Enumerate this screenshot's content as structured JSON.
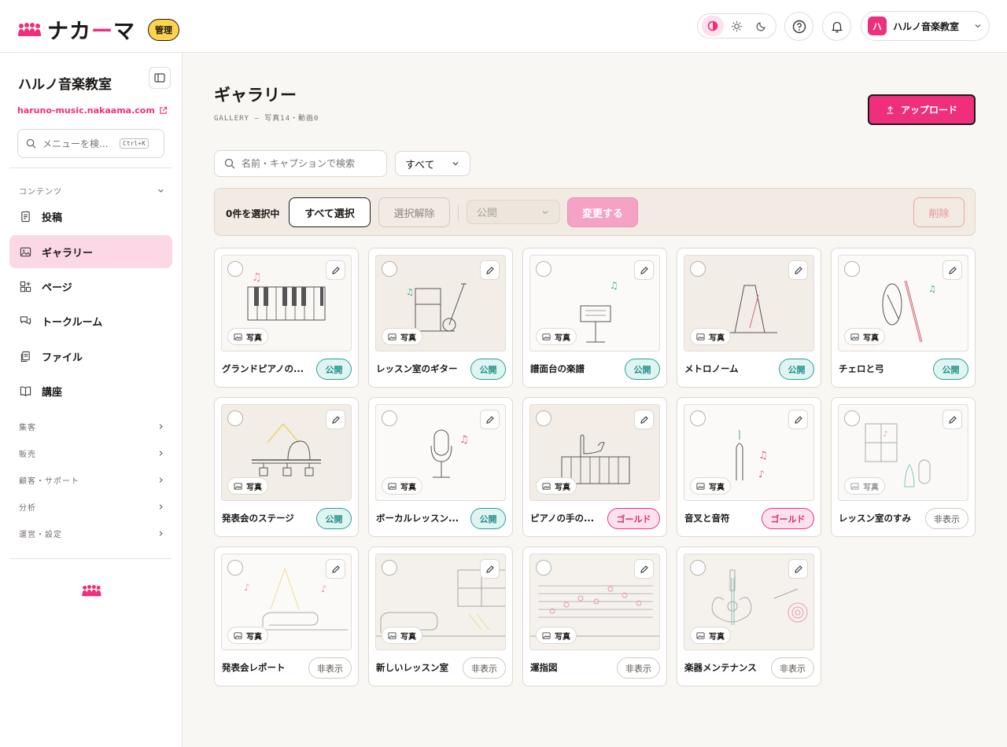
{
  "app": {
    "logo_text_pre": "ナカ",
    "logo_text_accent": "ー",
    "logo_text_post": "マ",
    "admin_badge": "管理"
  },
  "header": {
    "user_initial": "ハ",
    "user_name": "ハルノ音楽教室"
  },
  "sidebar": {
    "site_name": "ハルノ音楽教室",
    "site_url": "haruno-music.nakaama.com",
    "search_placeholder": "メニューを検...",
    "search_shortcut": "Ctrl+K",
    "content_section": "コンテンツ",
    "items": [
      {
        "label": "投稿",
        "icon": "document-icon"
      },
      {
        "label": "ギャラリー",
        "icon": "image-icon",
        "active": true
      },
      {
        "label": "ページ",
        "icon": "pages-icon"
      },
      {
        "label": "トークルーム",
        "icon": "chat-icon"
      },
      {
        "label": "ファイル",
        "icon": "file-icon"
      },
      {
        "label": "講座",
        "icon": "book-icon"
      }
    ],
    "sections": [
      "集客",
      "販売",
      "顧客・サポート",
      "分析",
      "運営・設定"
    ]
  },
  "page": {
    "title": "ギャラリー",
    "subtitle": "GALLERY — 写真14・動画0",
    "upload_label": "アップロード",
    "search_placeholder": "名前・キャプションで検索",
    "filter_value": "すべて"
  },
  "bulk": {
    "count_label": "0件を選択中",
    "select_all": "すべて選択",
    "deselect": "選択解除",
    "visibility_value": "公開",
    "apply": "変更する",
    "delete": "削除"
  },
  "type_label": "写真",
  "items": [
    {
      "title": "グランドピアノの...",
      "status": "公開",
      "kind": "public"
    },
    {
      "title": "レッスン室のギター",
      "status": "公開",
      "kind": "public"
    },
    {
      "title": "譜面台の楽譜",
      "status": "公開",
      "kind": "public"
    },
    {
      "title": "メトロノーム",
      "status": "公開",
      "kind": "public"
    },
    {
      "title": "チェロと弓",
      "status": "公開",
      "kind": "public"
    },
    {
      "title": "発表会のステージ",
      "status": "公開",
      "kind": "public"
    },
    {
      "title": "ボーカルレッスン...",
      "status": "公開",
      "kind": "public"
    },
    {
      "title": "ピアノの手の...",
      "status": "ゴールド",
      "kind": "gold"
    },
    {
      "title": "音叉と音符",
      "status": "ゴールド",
      "kind": "gold"
    },
    {
      "title": "レッスン室のすみ",
      "status": "非表示",
      "kind": "hidden"
    },
    {
      "title": "発表会レポート",
      "status": "非表示",
      "kind": "hidden"
    },
    {
      "title": "新しいレッスン室",
      "status": "非表示",
      "kind": "hidden"
    },
    {
      "title": "運指図",
      "status": "非表示",
      "kind": "hidden"
    },
    {
      "title": "楽器メンテナンス",
      "status": "非表示",
      "kind": "hidden"
    }
  ]
}
